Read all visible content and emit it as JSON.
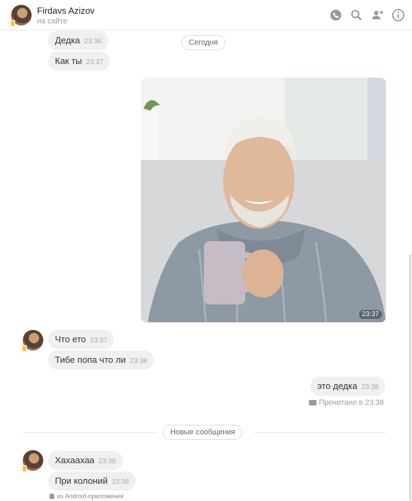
{
  "header": {
    "name": "Firdavs Azizov",
    "status": "на сайте",
    "icons": [
      "phone-icon",
      "search-icon",
      "add-user-icon",
      "info-icon"
    ]
  },
  "messages": {
    "m1": {
      "text": "Дедка",
      "time": "23:36"
    },
    "m2": {
      "text": "Как ты",
      "time": "23:37"
    },
    "photo_time": "23:37",
    "m3": {
      "text": "Что ето",
      "time": "23:37"
    },
    "m4": {
      "text": "Тибе попа что ли",
      "time": "23:38"
    },
    "m5": {
      "text": "это дедка",
      "time": "23:38"
    },
    "m6": {
      "text": "Хахаахаа",
      "time": "23:38"
    },
    "m7": {
      "text": "При колоний",
      "time": "23:38"
    }
  },
  "separators": {
    "today": "Сегодня",
    "new_messages": "Новые сообщения"
  },
  "read_receipt": "Прочитано в 23:38",
  "source_note": "из Android-приложения",
  "colors": {
    "bubble": "#f0f0f0",
    "mobile_badge": "#f2c230",
    "icon": "#9a9a9a"
  }
}
